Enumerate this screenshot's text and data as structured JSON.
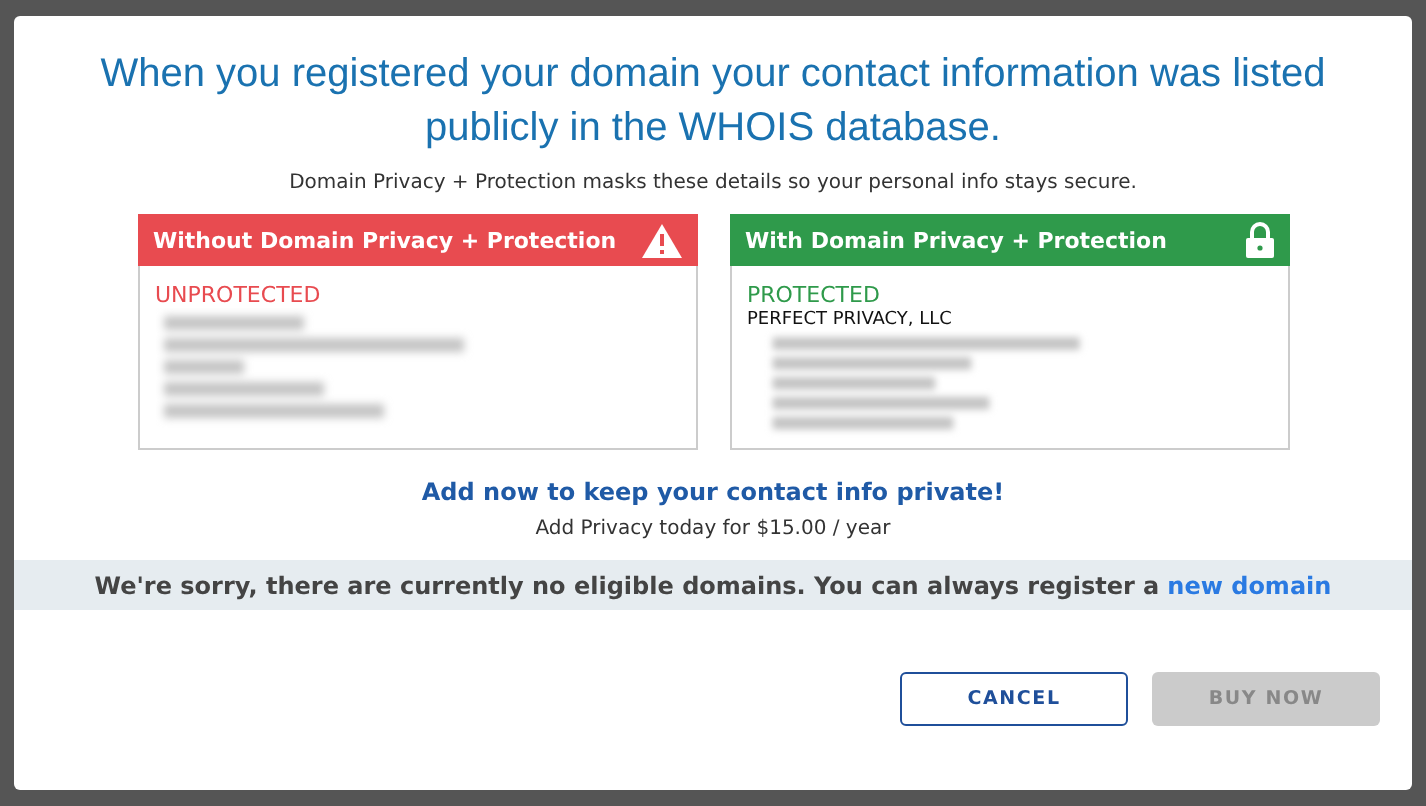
{
  "dialog": {
    "title": "When you registered your domain your contact information was listed publicly in the WHOIS database.",
    "subtitle": "Domain Privacy + Protection masks these details so your personal info stays secure.",
    "cards": [
      {
        "kind": "unprotected",
        "header": "Without Domain Privacy + Protection",
        "status": "UNPROTECTED"
      },
      {
        "kind": "protected",
        "header": "With Domain Privacy + Protection",
        "status": "PROTECTED",
        "name": "PERFECT PRIVACY, LLC"
      }
    ],
    "offer_link": "Add now to keep your contact info private!",
    "price_note": "Add Privacy today for $15.00 / year",
    "notice": {
      "text": "We're sorry, there are currently no eligible domains. You can always register a",
      "link": "new domain"
    },
    "buttons": [
      {
        "label": "CANCEL",
        "kind": "secondary",
        "disabled": false
      },
      {
        "label": "BUY NOW",
        "kind": "primary",
        "disabled": true
      }
    ]
  }
}
